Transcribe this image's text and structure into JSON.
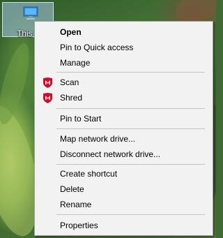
{
  "desktop": {
    "icon_label": "This P",
    "icon_name": "this-pc-icon"
  },
  "menu": {
    "open": "Open",
    "pin_quick_access": "Pin to Quick access",
    "manage": "Manage",
    "scan": "Scan",
    "shred": "Shred",
    "pin_start": "Pin to Start",
    "map_drive": "Map network drive...",
    "disconnect_drive": "Disconnect network drive...",
    "create_shortcut": "Create shortcut",
    "delete": "Delete",
    "rename": "Rename",
    "properties": "Properties"
  },
  "colors": {
    "menu_background": "#f2f2f2",
    "separator": "#c4c4c4",
    "mcafee_red": "#c8102e",
    "selection_highlight": "#a8c8e8"
  }
}
